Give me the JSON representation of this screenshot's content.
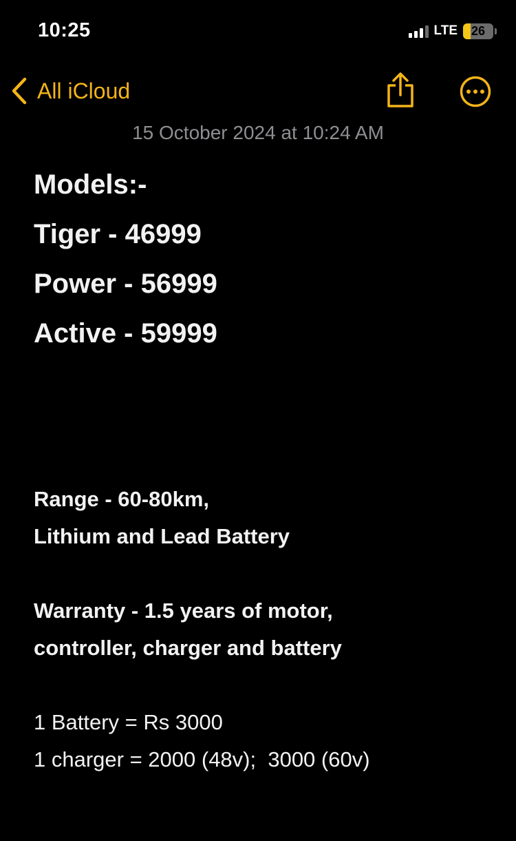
{
  "status_bar": {
    "time": "10:25",
    "network": "LTE",
    "battery_level": "26",
    "battery_fraction": 0.26,
    "signal_bars": 3,
    "signal_bars_total": 4
  },
  "nav": {
    "back_label": "All iCloud",
    "back_icon": "chevron-left-icon",
    "share_icon": "share-icon",
    "more_icon": "ellipsis-circle-icon"
  },
  "note": {
    "date": "15 October 2024 at 10:24 AM",
    "headings": [
      "Models:-",
      "Tiger - 46999",
      "Power - 56999",
      "Active - 59999"
    ],
    "range_line1": "Range - 60-80km,",
    "range_line2": "Lithium and Lead Battery",
    "warranty_line1": "Warranty - 1.5 years of motor,",
    "warranty_line2": "controller, charger and battery",
    "battery_price": "1 Battery = Rs 3000",
    "charger_price": "1 charger = 2000 (48v);  3000 (60v)"
  },
  "colors": {
    "accent": "#f4b41a",
    "background": "#000000",
    "text": "#f2f2f2",
    "secondary_text": "#8e8e93"
  }
}
